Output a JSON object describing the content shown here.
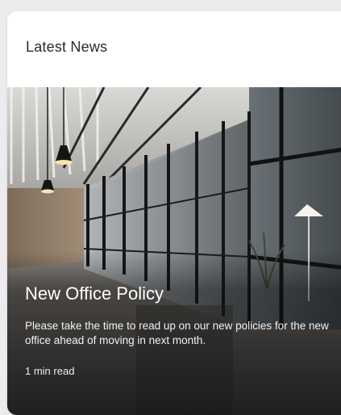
{
  "card": {
    "title": "Latest News"
  },
  "article": {
    "title": "New Office Policy",
    "excerpt": "Please take the time to read up on our new policies for the new office ahead of moving in next month.",
    "read_time": "1 min read"
  }
}
